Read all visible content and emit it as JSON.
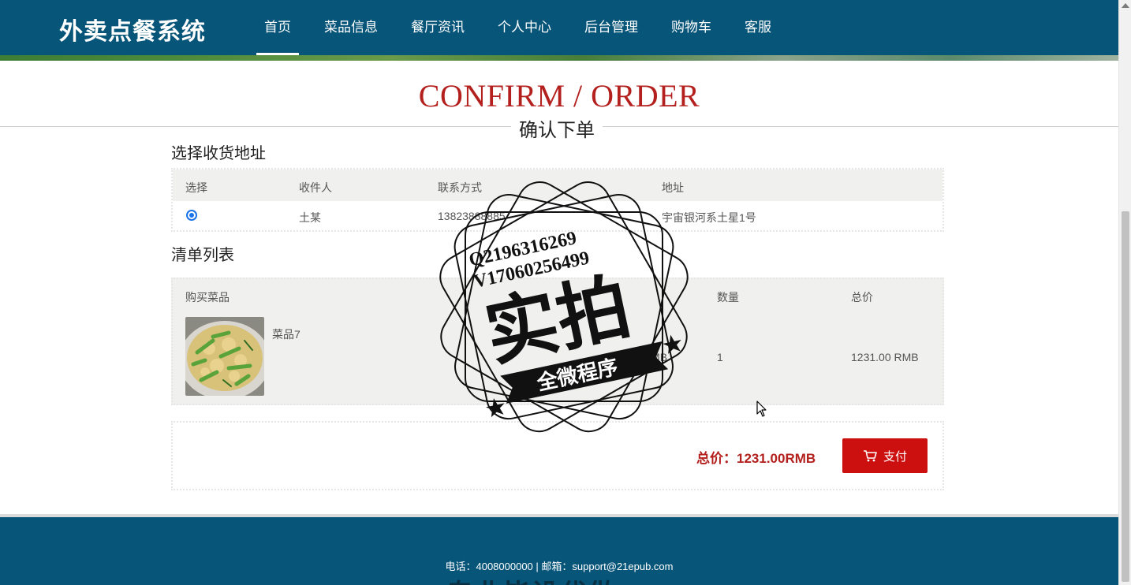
{
  "app": {
    "title": "外卖点餐系统"
  },
  "nav": {
    "items": [
      {
        "label": "首页",
        "active": true
      },
      {
        "label": "菜品信息"
      },
      {
        "label": "餐厅资讯"
      },
      {
        "label": "个人中心"
      },
      {
        "label": "后台管理"
      },
      {
        "label": "购物车"
      },
      {
        "label": "客服"
      }
    ]
  },
  "page": {
    "title_en": "CONFIRM / ORDER",
    "title_cn": "确认下单"
  },
  "address": {
    "section_title": "选择收货地址",
    "headers": [
      "选择",
      "收件人",
      "联系方式",
      "地址"
    ],
    "rows": [
      {
        "selected": true,
        "recipient": "土某",
        "phone": "13823888885",
        "address": "宇宙银河系土星1号"
      }
    ]
  },
  "order": {
    "section_title": "清单列表",
    "headers": [
      "购买菜品",
      "数量",
      "总价"
    ],
    "items": [
      {
        "name": "菜品7",
        "price_fragment": "RMB",
        "quantity": "1",
        "total": "1231.00 RMB"
      }
    ]
  },
  "summary": {
    "total_label": "总价：1231.00RMB",
    "pay_label": "支付"
  },
  "footer": {
    "contact": "电话：4008000000 | 邮箱：support@21epub.com",
    "overlay_text": "专业毕设代做"
  },
  "watermark": {
    "line1": "Q2196316269",
    "line2": "V17060256499",
    "main": "实拍",
    "ribbon": "全微程序"
  },
  "colors": {
    "header_bg": "#08557a",
    "accent_red": "#b3201e",
    "pay_button": "#cc1010",
    "radio": "#1a73e8"
  },
  "icons": {
    "pay": "cart-icon",
    "radio": "radio-checked-icon"
  }
}
